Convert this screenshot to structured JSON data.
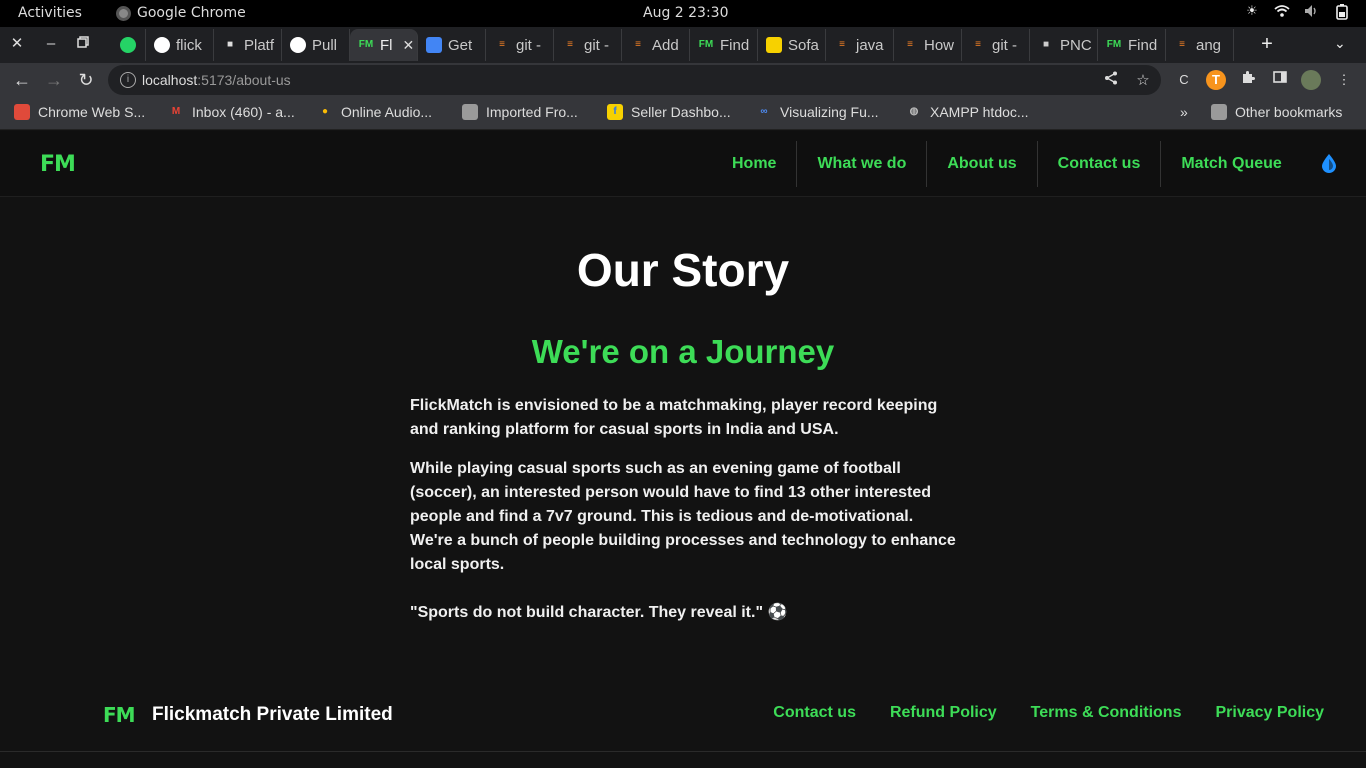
{
  "os_bar": {
    "activities": "Activities",
    "app_name": "Google Chrome",
    "clock": "Aug 2  23:30"
  },
  "browser": {
    "tabs": [
      {
        "label": "",
        "icon": "whatsapp-icon",
        "color": "#25d366"
      },
      {
        "label": "flick",
        "icon": "github-icon",
        "color": "#ffffff"
      },
      {
        "label": "Platf",
        "icon": "platform-icon",
        "color": "#dddddd"
      },
      {
        "label": "Pull",
        "icon": "github-icon",
        "color": "#ffffff"
      },
      {
        "label": "Fl",
        "icon": "flickmatch-icon",
        "color": "#3ddc57",
        "active": true
      },
      {
        "label": "Get",
        "icon": "docs-icon",
        "color": "#4285f4"
      },
      {
        "label": "git -",
        "icon": "stackoverflow-icon",
        "color": "#f48024"
      },
      {
        "label": "git -",
        "icon": "stackoverflow-icon",
        "color": "#f48024"
      },
      {
        "label": "Add",
        "icon": "stackoverflow-icon",
        "color": "#f48024"
      },
      {
        "label": "Find",
        "icon": "flickmatch-icon",
        "color": "#3ddc57"
      },
      {
        "label": "Sofa",
        "icon": "flipkart-icon",
        "color": "#f7d100"
      },
      {
        "label": "java",
        "icon": "stackoverflow-icon",
        "color": "#f48024"
      },
      {
        "label": "How",
        "icon": "stackoverflow-icon",
        "color": "#f48024"
      },
      {
        "label": "git -",
        "icon": "stackoverflow-icon",
        "color": "#f48024"
      },
      {
        "label": "PNC",
        "icon": "pnc-icon",
        "color": "#cccccc"
      },
      {
        "label": "Find",
        "icon": "flickmatch-icon",
        "color": "#3ddc57"
      },
      {
        "label": "ang",
        "icon": "stackoverflow-icon",
        "color": "#f48024"
      }
    ],
    "url_host": "localhost",
    "url_path": ":5173/about-us",
    "bookmarks": [
      {
        "label": "Chrome Web S...",
        "icon": "webstore-icon"
      },
      {
        "label": "Inbox (460) - a...",
        "icon": "gmail-icon"
      },
      {
        "label": "Online Audio...",
        "icon": "audio-icon"
      },
      {
        "label": "Imported Fro...",
        "icon": "folder-icon"
      },
      {
        "label": "Seller Dashbo...",
        "icon": "flipkart-icon"
      },
      {
        "label": "Visualizing Fu...",
        "icon": "link-icon"
      },
      {
        "label": "XAMPP htdoc...",
        "icon": "globe-icon"
      }
    ],
    "other_bookmarks": "Other bookmarks"
  },
  "site": {
    "logo": "FM",
    "nav": [
      "Home",
      "What we do",
      "About us",
      "Contact us",
      "Match Queue"
    ],
    "accent": "#3ddc57"
  },
  "main": {
    "title": "Our Story",
    "subtitle": "We're on a Journey",
    "paragraph1": "FlickMatch is envisioned to be a matchmaking, player record keeping and ranking platform for casual sports in India and USA.",
    "paragraph2": "While playing casual sports such as an evening game of football (soccer), an interested person would have to find 13 other interested people and find a 7v7 ground. This is tedious and de-motivational. We're a bunch of people building processes and technology to enhance local sports.",
    "quote": "\"Sports do not build character. They reveal it.\" ⚽"
  },
  "footer": {
    "logo": "FM",
    "company": "Flickmatch Private Limited",
    "links": [
      "Contact us",
      "Refund Policy",
      "Terms & Conditions",
      "Privacy Policy"
    ]
  }
}
